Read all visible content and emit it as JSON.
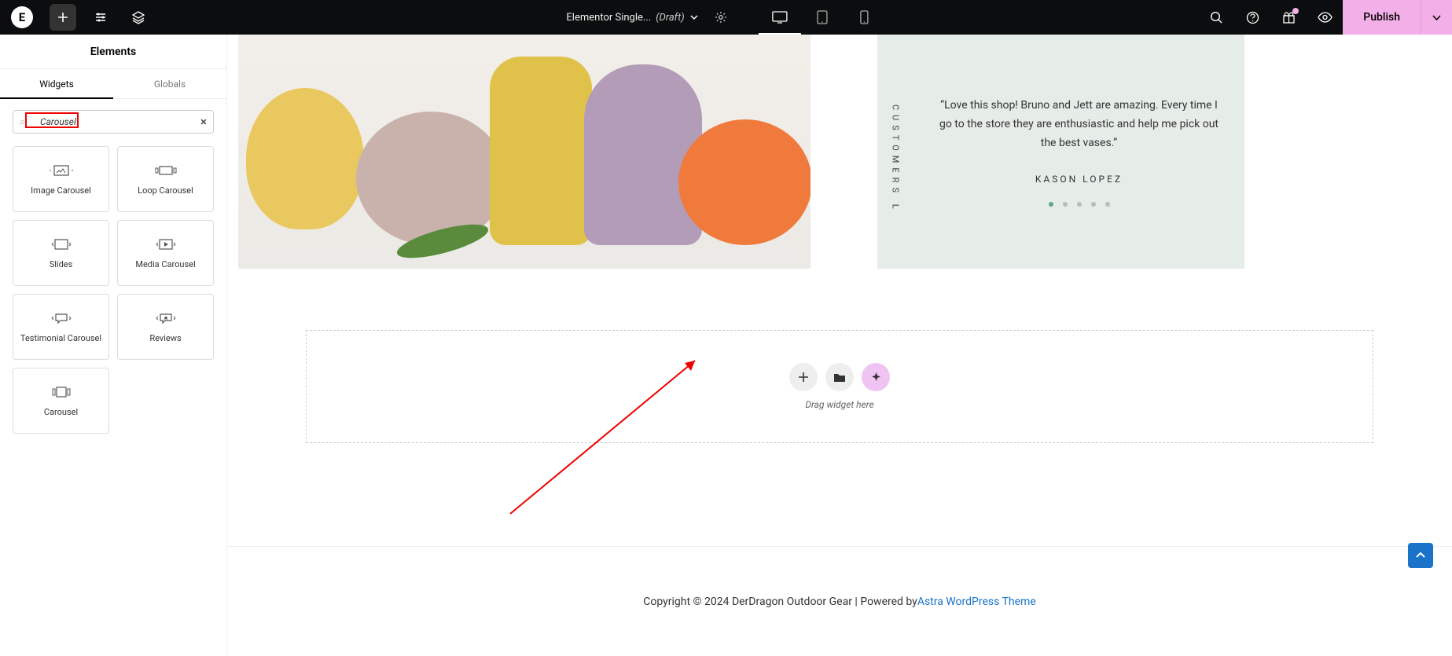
{
  "topbar": {
    "logo_letter": "E",
    "title": "Elementor Single...",
    "status": "(Draft)",
    "publish_label": "Publish"
  },
  "sidebar": {
    "title": "Elements",
    "tabs": {
      "widgets": "Widgets",
      "globals": "Globals"
    },
    "search_value": "Carousel",
    "widgets": [
      "Image Carousel",
      "Loop Carousel",
      "Slides",
      "Media Carousel",
      "Testimonial Carousel",
      "Reviews",
      "Carousel"
    ]
  },
  "testimonial": {
    "side_label": "CUSTOMERS L",
    "quote": "“Love this shop! Bruno and Jett are amazing. Every time I go to the store they are enthusiastic and help me pick out the best vases.”",
    "author": "KASON LOPEZ"
  },
  "dropzone": {
    "label": "Drag widget here"
  },
  "footer": {
    "prefix": "Copyright © 2024 DerDragon Outdoor Gear | Powered by ",
    "link": "Astra WordPress Theme"
  }
}
